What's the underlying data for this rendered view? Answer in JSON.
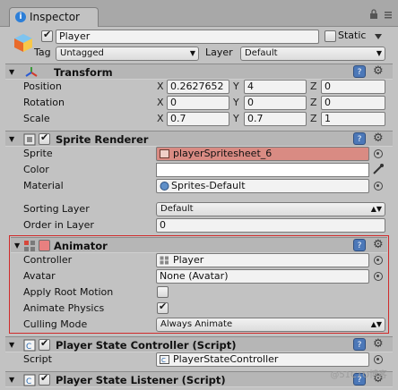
{
  "tab": {
    "label": "Inspector"
  },
  "header": {
    "name": "Player",
    "static_label": "Static",
    "tag_label": "Tag",
    "tag_value": "Untagged",
    "layer_label": "Layer",
    "layer_value": "Default"
  },
  "transform": {
    "title": "Transform",
    "position": {
      "label": "Position",
      "x": "0.2627652",
      "y": "4",
      "z": "0"
    },
    "rotation": {
      "label": "Rotation",
      "x": "0",
      "y": "0",
      "z": "0"
    },
    "scale": {
      "label": "Scale",
      "x": "0.7",
      "y": "0.7",
      "z": "1"
    }
  },
  "sprite_renderer": {
    "title": "Sprite Renderer",
    "sprite_label": "Sprite",
    "sprite_value": "playerSpritesheet_6",
    "color_label": "Color",
    "material_label": "Material",
    "material_value": "Sprites-Default",
    "sorting_layer_label": "Sorting Layer",
    "sorting_layer_value": "Default",
    "order_label": "Order in Layer",
    "order_value": "0"
  },
  "animator": {
    "title": "Animator",
    "controller_label": "Controller",
    "controller_value": "Player",
    "avatar_label": "Avatar",
    "avatar_value": "None (Avatar)",
    "apply_root_motion_label": "Apply Root Motion",
    "animate_physics_label": "Animate Physics",
    "culling_mode_label": "Culling Mode",
    "culling_mode_value": "Always Animate"
  },
  "state_controller": {
    "title": "Player State Controller (Script)",
    "script_label": "Script",
    "script_value": "PlayerStateController"
  },
  "state_listener": {
    "title": "Player State Listener (Script)"
  },
  "axes": {
    "x": "X",
    "y": "Y",
    "z": "Z"
  },
  "watermark": "@51CTO博客",
  "colors": {
    "sprite_field": "#d98b83",
    "animator_outline": "#d02a2a",
    "help_icon": "#4c78b8"
  }
}
